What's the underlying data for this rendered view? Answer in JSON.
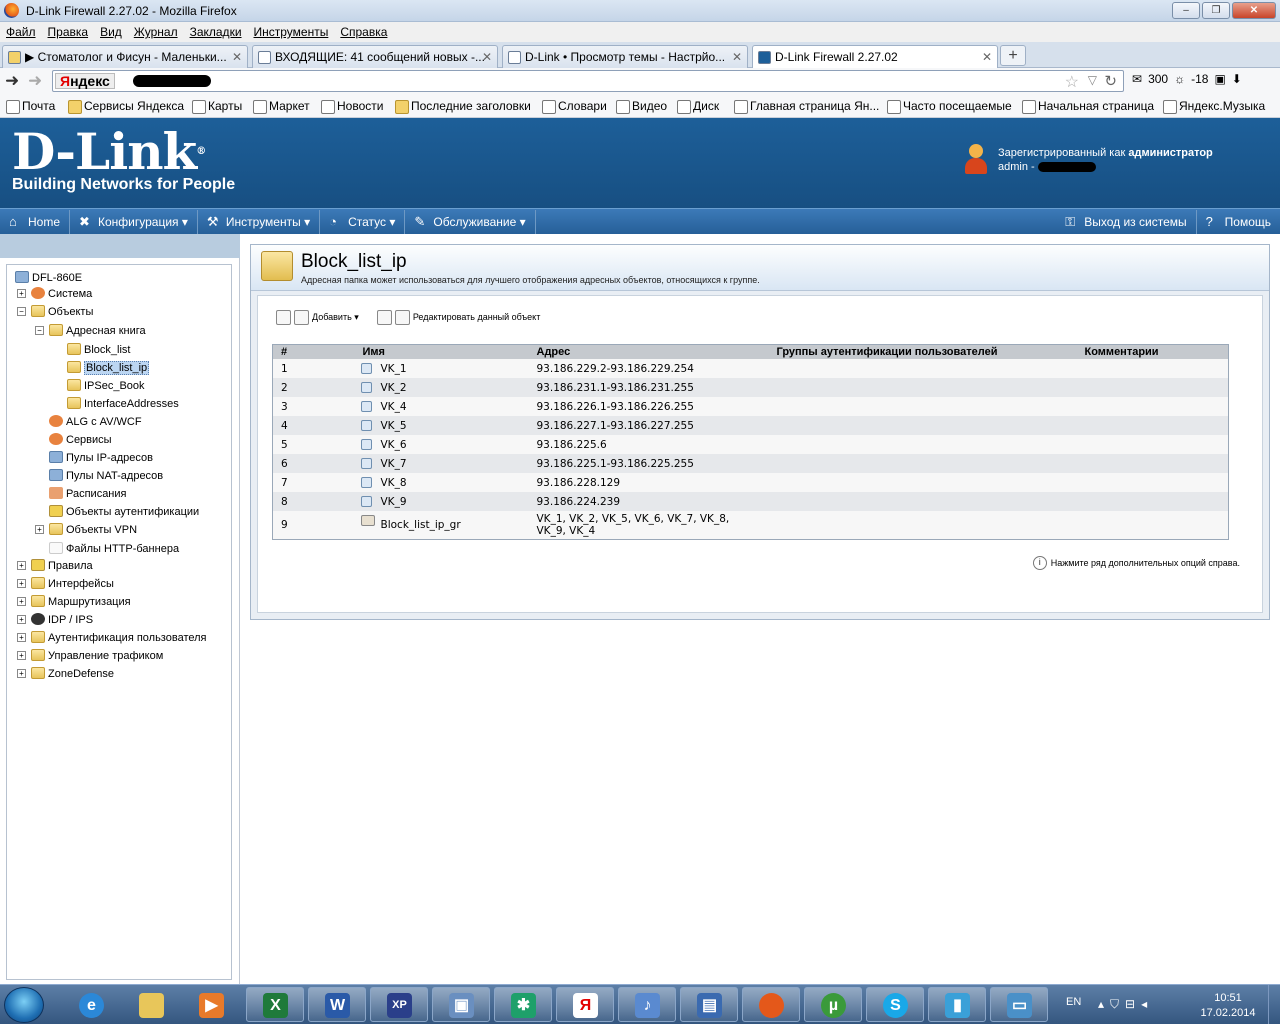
{
  "window": {
    "title": "D-Link Firewall 2.27.02 - Mozilla Firefox"
  },
  "menu": [
    "Файл",
    "Правка",
    "Вид",
    "Журнал",
    "Закладки",
    "Инструменты",
    "Справка"
  ],
  "tabs": [
    {
      "label": "▶ Стоматолог и Фисун - Маленьки..."
    },
    {
      "label": "ВХОДЯЩИЕ: 41 сообщений новых -..."
    },
    {
      "label": "D-Link • Просмотр темы - Настрйо..."
    },
    {
      "label": "D-Link Firewall 2.27.02"
    }
  ],
  "nav": {
    "search_logo_y": "Я",
    "search_logo_rest": "ндекс",
    "mail_count": "300",
    "weather": "-18"
  },
  "bookmarks": [
    "Почта",
    "Сервисы Яндекса",
    "Карты",
    "Маркет",
    "Новости",
    "Последние заголовки",
    "Словари",
    "Видео",
    "Диск",
    "Главная страница Ян...",
    "Часто посещаемые",
    "Начальная страница",
    "Яндекс.Музыка"
  ],
  "header": {
    "logo": "D-Link",
    "tagline": "Building Networks for People",
    "reg_prefix": "Зарегистрированный как",
    "reg_role": "администратор",
    "user": "admin -"
  },
  "topnav": {
    "home": "Home",
    "config": "Конфигурация",
    "tools": "Инструменты",
    "status": "Статус",
    "maintenance": "Обслуживание",
    "logout": "Выход из системы",
    "help": "Помощь"
  },
  "tree": {
    "root": "DFL-860E",
    "system": "Система",
    "objects": "Объекты",
    "addressbook": "Адресная книга",
    "block_list": "Block_list",
    "block_list_ip": "Block_list_ip",
    "ipsec_book": "IPSec_Book",
    "iface_addr": "InterfaceAddresses",
    "alg": "ALG с AV/WCF",
    "services": "Сервисы",
    "ip_pools": "Пулы IP-адресов",
    "nat_pools": "Пулы NAT-адресов",
    "schedules": "Расписания",
    "auth_objects": "Объекты аутентификации",
    "vpn_objects": "Объекты VPN",
    "http_banner": "Файлы HTTP-баннера",
    "rules": "Правила",
    "interfaces": "Интерфейсы",
    "routing": "Маршрутизация",
    "idp": "IDP / IPS",
    "user_auth": "Аутентификация пользователя",
    "traffic": "Управление трафиком",
    "zonedefense": "ZoneDefense"
  },
  "page": {
    "title": "Block_list_ip",
    "description": "Адресная папка может использоваться для лучшего отображения адресных объектов, относящихся к группе.",
    "add": "Добавить",
    "edit": "Редактировать данный объект",
    "hint": "Нажмите ряд дополнительных опций справа."
  },
  "table": {
    "headers": [
      "#",
      "Имя",
      "Адрес",
      "Группы аутентификации пользователей",
      "Комментарии"
    ],
    "rows": [
      {
        "n": "1",
        "name": "VK_1",
        "addr": "93.186.229.2-93.186.229.254",
        "groups": "",
        "comment": ""
      },
      {
        "n": "2",
        "name": "VK_2",
        "addr": "93.186.231.1-93.186.231.255",
        "groups": "",
        "comment": ""
      },
      {
        "n": "3",
        "name": "VK_4",
        "addr": "93.186.226.1-93.186.226.255",
        "groups": "",
        "comment": ""
      },
      {
        "n": "4",
        "name": "VK_5",
        "addr": "93.186.227.1-93.186.227.255",
        "groups": "",
        "comment": ""
      },
      {
        "n": "5",
        "name": "VK_6",
        "addr": "93.186.225.6",
        "groups": "",
        "comment": ""
      },
      {
        "n": "6",
        "name": "VK_7",
        "addr": "93.186.225.1-93.186.225.255",
        "groups": "",
        "comment": ""
      },
      {
        "n": "7",
        "name": "VK_8",
        "addr": "93.186.228.129",
        "groups": "",
        "comment": ""
      },
      {
        "n": "8",
        "name": "VK_9",
        "addr": "93.186.224.239",
        "groups": "",
        "comment": ""
      },
      {
        "n": "9",
        "name": "Block_list_ip_gr",
        "addr": "VK_1, VK_2, VK_5, VK_6, VK_7, VK_8, VK_9, VK_4",
        "groups": "",
        "comment": ""
      }
    ]
  },
  "taskbar": {
    "lang": "EN",
    "time": "10:51",
    "date": "17.02.2014"
  }
}
